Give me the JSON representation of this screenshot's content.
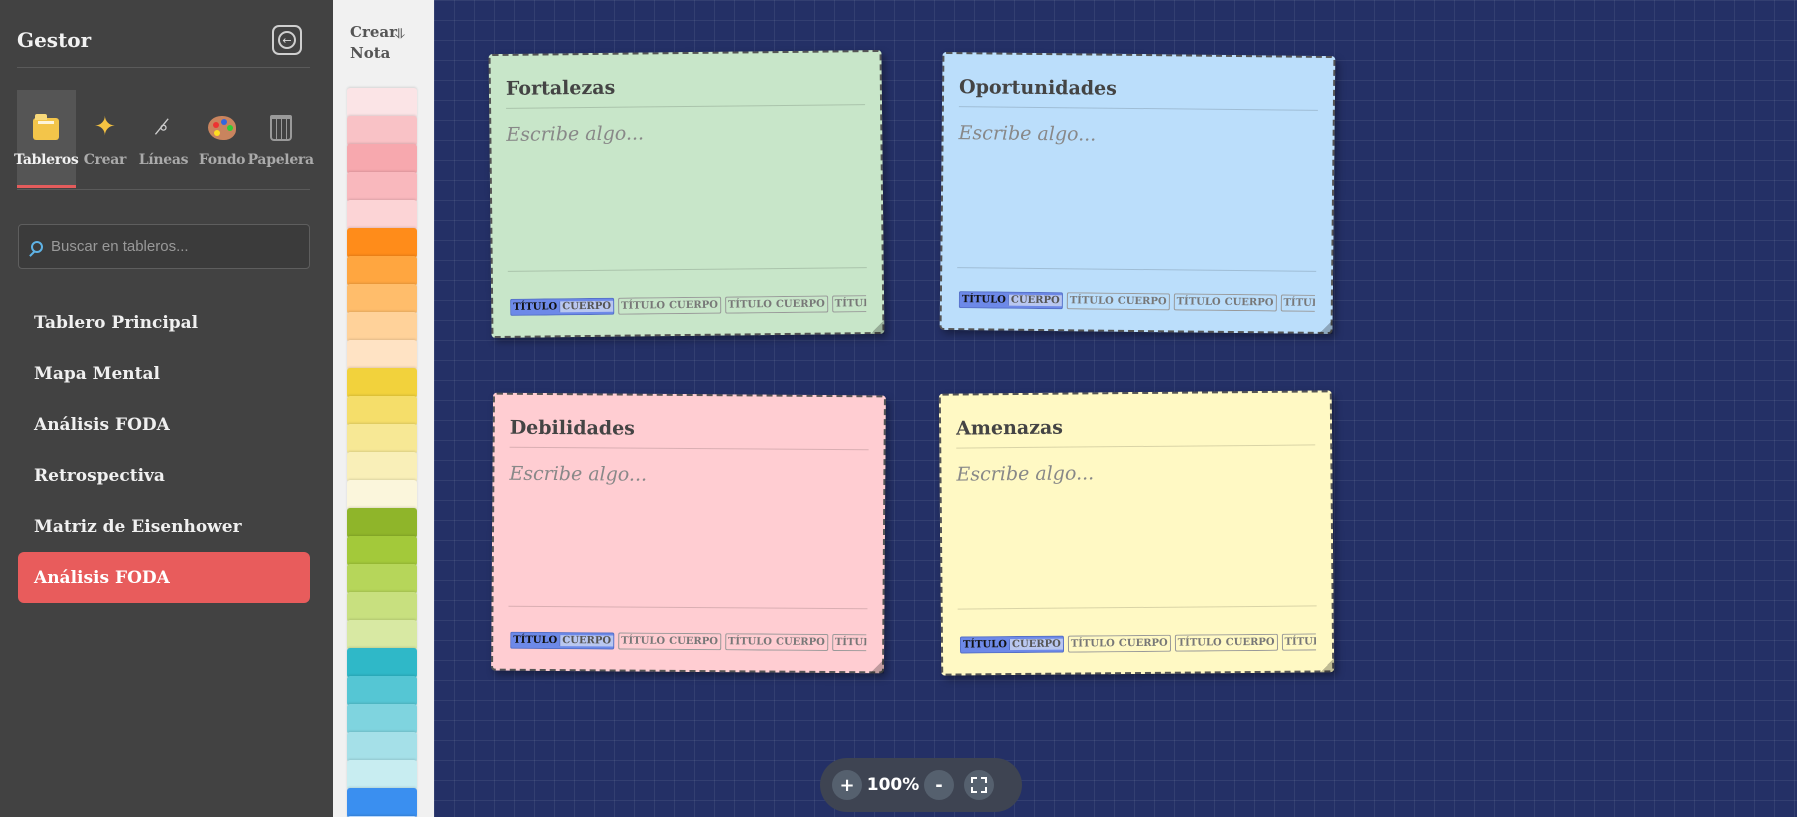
{
  "sidebar": {
    "title": "Gestor",
    "tabs": [
      {
        "label": "Tableros",
        "icon": "folder-icon"
      },
      {
        "label": "Crear",
        "icon": "sparkles-icon"
      },
      {
        "label": "Líneas",
        "icon": "link-icon"
      },
      {
        "label": "Fondo",
        "icon": "palette-icon"
      },
      {
        "label": "Papelera",
        "icon": "trash-icon"
      }
    ],
    "search_placeholder": "Buscar en tableros...",
    "boards": [
      "Tablero Principal",
      "Mapa Mental",
      "Análisis FODA",
      "Retrospectiva",
      "Matriz de Eisenhower",
      "Análisis FODA"
    ],
    "active_board_index": 5
  },
  "palette": {
    "create_label": "Crear Nota",
    "colors": [
      "#fbe4e6",
      "#f9c2c6",
      "#f7a8ae",
      "#f9b8bd",
      "#fcd4d6",
      "#ff8c1a",
      "#ffa640",
      "#ffbd6b",
      "#ffd29a",
      "#ffe3c4",
      "#f2d23c",
      "#f5de6a",
      "#f7e895",
      "#f9efb8",
      "#fbf6dc",
      "#8fb52a",
      "#a3c93a",
      "#b6d65a",
      "#c8e07f",
      "#d8e9a3",
      "#2fb8c8",
      "#55c6d4",
      "#7fd4df",
      "#a5e0e8",
      "#c8edf1",
      "#3a8ff0",
      "#b9d8fb"
    ]
  },
  "notes": [
    {
      "title": "Fortalezas",
      "placeholder": "Escribe algo...",
      "color": "#c8e6c9"
    },
    {
      "title": "Oportunidades",
      "placeholder": "Escribe algo...",
      "color": "#bbdefb"
    },
    {
      "title": "Debilidades",
      "placeholder": "Escribe algo...",
      "color": "#ffcdd2"
    },
    {
      "title": "Amenazas",
      "placeholder": "Escribe algo...",
      "color": "#fff9c4"
    }
  ],
  "note_tools": {
    "title": "TÍTULO",
    "body": "CUERPO",
    "truncated": "TÍTULO CU"
  },
  "zoom": {
    "plus": "+",
    "value": "100%",
    "minus": "-"
  }
}
